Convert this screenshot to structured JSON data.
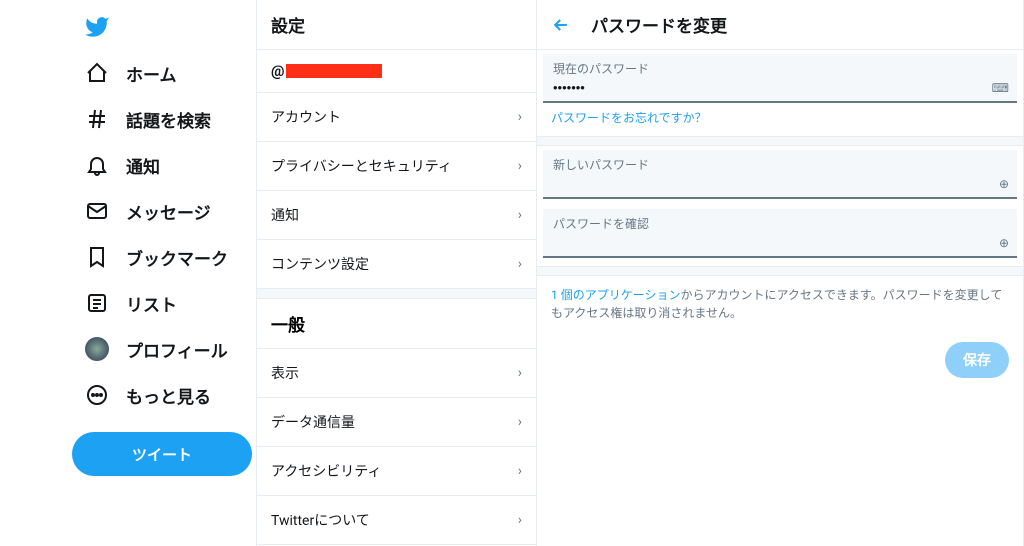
{
  "nav": {
    "home": "ホーム",
    "explore": "話題を検索",
    "notifications": "通知",
    "messages": "メッセージ",
    "bookmarks": "ブックマーク",
    "lists": "リスト",
    "profile": "プロフィール",
    "more": "もっと見る",
    "tweet": "ツイート"
  },
  "settings": {
    "title": "設定",
    "handle_prefix": "@",
    "items": {
      "account": "アカウント",
      "privacy": "プライバシーとセキュリティ",
      "notifications": "通知",
      "content": "コンテンツ設定"
    },
    "general_header": "一般",
    "general": {
      "display": "表示",
      "data": "データ通信量",
      "accessibility": "アクセシビリティ",
      "about": "Twitterについて"
    }
  },
  "detail": {
    "title": "パスワードを変更",
    "current_label": "現在のパスワード",
    "current_value": "•••••••",
    "forgot": "パスワードをお忘れですか？",
    "new_label": "新しいパスワード",
    "confirm_label": "パスワードを確認",
    "apps_link": "1 個のアプリケーション",
    "apps_text": "からアカウントにアクセスできます。パスワードを変更してもアクセス権は取り消されません。",
    "save": "保存"
  },
  "colors": {
    "accent": "#1da1f2"
  }
}
